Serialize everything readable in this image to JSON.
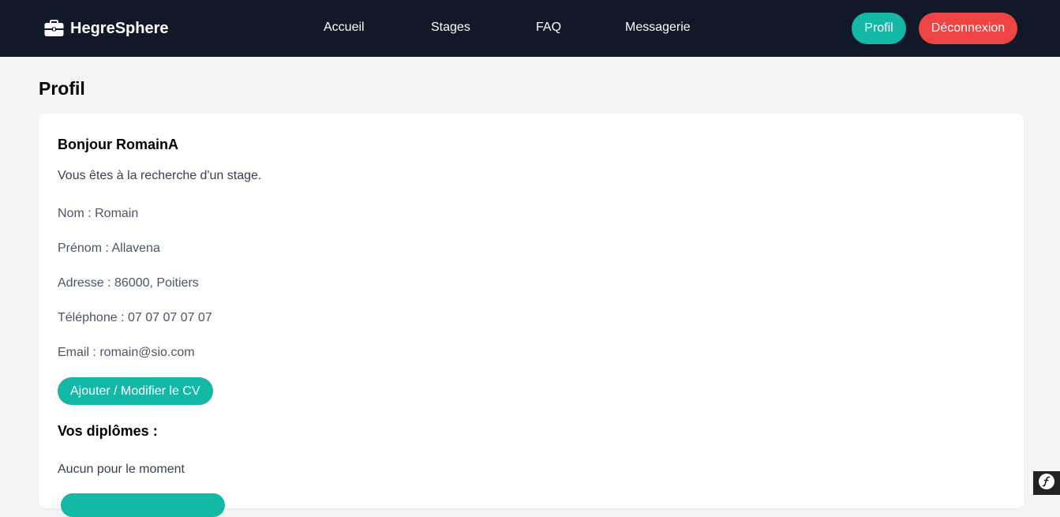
{
  "header": {
    "brand": "HegreSphere",
    "brand_icon": "briefcase-icon",
    "nav": [
      "Accueil",
      "Stages",
      "FAQ",
      "Messagerie"
    ],
    "profil_label": "Profil",
    "logout_label": "Déconnexion"
  },
  "page": {
    "title": "Profil"
  },
  "profile": {
    "greeting": "Bonjour RomainA",
    "status": "Vous êtes à la recherche d'un stage.",
    "nom": "Nom : Romain",
    "prenom": "Prénom : Allavena",
    "adresse": "Adresse : 86000, Poitiers",
    "telephone": "Téléphone : 07 07 07 07 07",
    "email": "Email : romain@sio.com",
    "cv_button": "Ajouter / Modifier le CV",
    "diplomes_heading": "Vos diplômes :",
    "diplomes_empty": "Aucun pour le moment"
  },
  "colors": {
    "navbar": "#111827",
    "accent": "#14b8a6",
    "danger": "#ef4444",
    "page_bg": "#f3f4f6"
  },
  "debug": {
    "icon": "symfony-icon"
  }
}
